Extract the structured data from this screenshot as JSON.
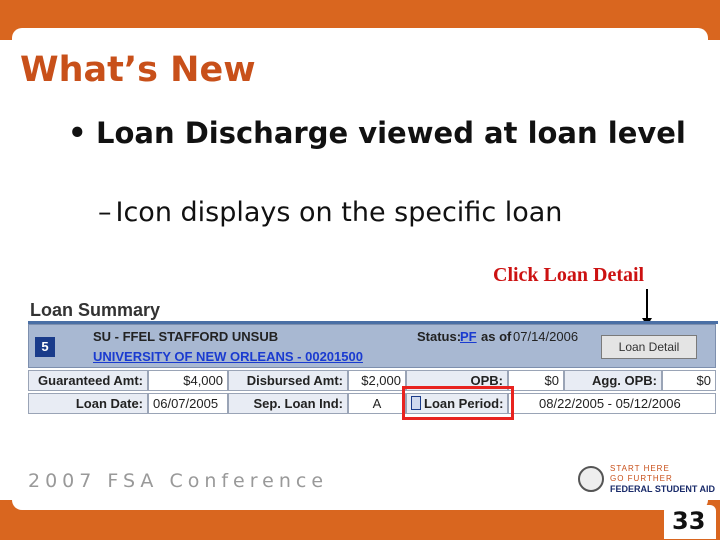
{
  "slide": {
    "title": "What’s New",
    "bullet": "Loan Discharge viewed at loan level",
    "bullet_marker": "•",
    "sub_marker": "–",
    "sub_bullet": "Icon displays on the specific loan",
    "callout": "Click Loan Detail",
    "footer": "2007 FSA Conference",
    "page_number": "33",
    "logo": {
      "line1": "START HERE",
      "line2": "GO FURTHER",
      "line3": "FEDERAL STUDENT AID"
    },
    "colors": {
      "band": "#d9661f",
      "title": "#c8501a",
      "callout": "#cc1111",
      "highlight": "#e8231f"
    }
  },
  "loan_summary": {
    "heading": "Loan Summary",
    "loan_number": "5",
    "loan_type": "SU - FFEL STAFFORD UNSUB",
    "school": "UNIVERSITY OF NEW ORLEANS  - 00201500",
    "status_label": "Status:",
    "status_code": "PF",
    "as_of_label": "as of",
    "status_date": "07/14/2006",
    "loan_detail_button": "Loan Detail",
    "row1": {
      "guaranteed_label": "Guaranteed Amt:",
      "guaranteed_value": "$4,000",
      "disbursed_label": "Disbursed Amt:",
      "disbursed_value": "$2,000",
      "opb_label": "OPB:",
      "opb_value": "$0",
      "agg_opb_label": "Agg. OPB:",
      "agg_opb_value": "$0"
    },
    "row2": {
      "loan_date_label": "Loan Date:",
      "loan_date_value": "06/07/2005",
      "sep_label": "Sep. Loan Ind:",
      "sep_value": "A",
      "loan_period_label": "Loan Period:",
      "loan_period_value": "08/22/2005 - 05/12/2006"
    },
    "discharge_icon": "discharge-icon"
  }
}
